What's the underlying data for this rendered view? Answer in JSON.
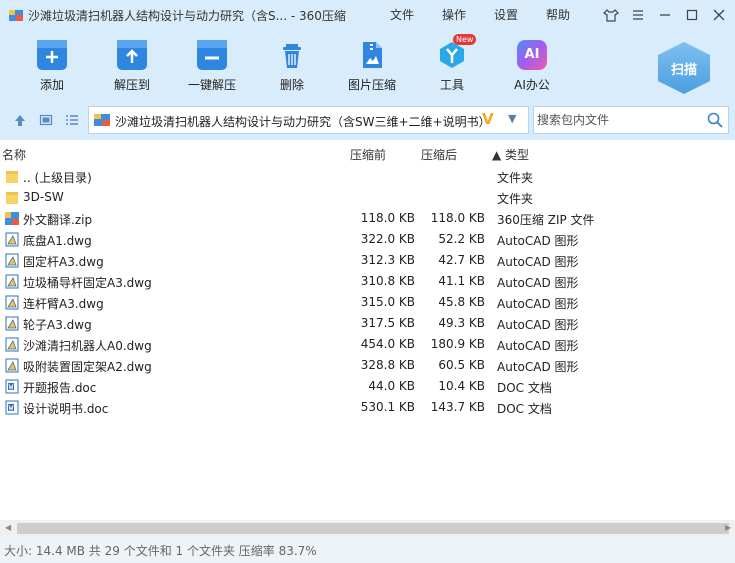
{
  "window": {
    "title": "沙滩垃圾清扫机器人结构设计与动力研究（含S... - 360压缩",
    "menus": [
      "文件",
      "操作",
      "设置",
      "帮助"
    ]
  },
  "toolbar": {
    "tools": [
      {
        "label": "添加",
        "icon": "add-icon",
        "color": "#2f86e0"
      },
      {
        "label": "解压到",
        "icon": "extract-to-icon",
        "color": "#2f86e0"
      },
      {
        "label": "一键解压",
        "icon": "one-click-extract-icon",
        "color": "#2f86e0"
      },
      {
        "label": "删除",
        "icon": "trash-icon",
        "color": "#2f86e0"
      },
      {
        "label": "图片压缩",
        "icon": "image-compress-icon",
        "color": "#2f86e0"
      },
      {
        "label": "工具",
        "icon": "tools-icon",
        "color": "#2aa8e8",
        "badge": "New"
      },
      {
        "label": "AI办公",
        "icon": "ai-office-icon",
        "color": "#8a5cf6",
        "glyph": "AI"
      }
    ],
    "scan_label": "扫描"
  },
  "address": {
    "path": "沙滩垃圾清扫机器人结构设计与动力研究（含SW三维+二维+说明书）",
    "search_placeholder": "搜索包内文件"
  },
  "columns": {
    "name": "名称",
    "size": "压缩前",
    "packed": "压缩后",
    "type": "▲ 类型"
  },
  "files": [
    {
      "name": ".. (上级目录)",
      "size": "",
      "packed": "",
      "type": "文件夹",
      "icon": "folder"
    },
    {
      "name": "3D-SW",
      "size": "",
      "packed": "",
      "type": "文件夹",
      "icon": "folder"
    },
    {
      "name": "外文翻译.zip",
      "size": "118.0 KB",
      "packed": "118.0 KB",
      "type": "360压缩 ZIP 文件",
      "icon": "zip"
    },
    {
      "name": "底盘A1.dwg",
      "size": "322.0 KB",
      "packed": "52.2 KB",
      "type": "AutoCAD 图形",
      "icon": "dwg"
    },
    {
      "name": "固定杆A3.dwg",
      "size": "312.3 KB",
      "packed": "42.7 KB",
      "type": "AutoCAD 图形",
      "icon": "dwg"
    },
    {
      "name": "垃圾桶导杆固定A3.dwg",
      "size": "310.8 KB",
      "packed": "41.1 KB",
      "type": "AutoCAD 图形",
      "icon": "dwg"
    },
    {
      "name": "连杆臂A3.dwg",
      "size": "315.0 KB",
      "packed": "45.8 KB",
      "type": "AutoCAD 图形",
      "icon": "dwg"
    },
    {
      "name": "轮子A3.dwg",
      "size": "317.5 KB",
      "packed": "49.3 KB",
      "type": "AutoCAD 图形",
      "icon": "dwg"
    },
    {
      "name": "沙滩清扫机器人A0.dwg",
      "size": "454.0 KB",
      "packed": "180.9 KB",
      "type": "AutoCAD 图形",
      "icon": "dwg"
    },
    {
      "name": "吸附装置固定架A2.dwg",
      "size": "328.8 KB",
      "packed": "60.5 KB",
      "type": "AutoCAD 图形",
      "icon": "dwg"
    },
    {
      "name": "开题报告.doc",
      "size": "44.0 KB",
      "packed": "10.4 KB",
      "type": "DOC 文档",
      "icon": "doc"
    },
    {
      "name": "设计说明书.doc",
      "size": "530.1 KB",
      "packed": "143.7 KB",
      "type": "DOC 文档",
      "icon": "doc"
    }
  ],
  "status": "大小: 14.4 MB 共 29 个文件和 1 个文件夹 压缩率 83.7%"
}
